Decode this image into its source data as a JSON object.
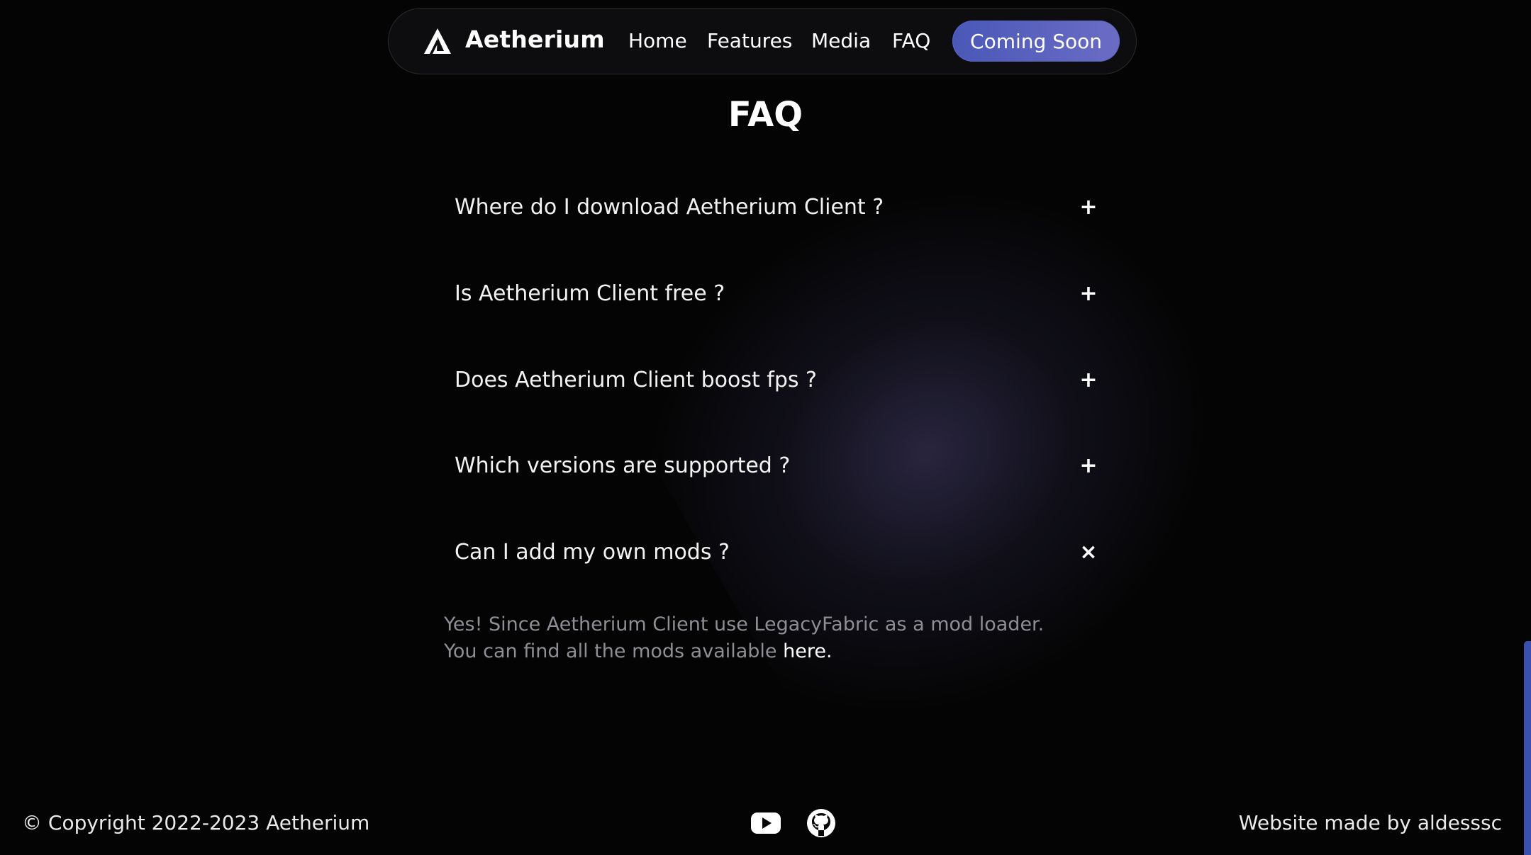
{
  "nav": {
    "brand": "Aetherium",
    "links": [
      "Home",
      "Features",
      "Media",
      "FAQ"
    ],
    "cta": "Coming Soon"
  },
  "faq": {
    "title": "FAQ",
    "items": [
      {
        "question": "Where do I download Aetherium Client ?",
        "toggle": "+"
      },
      {
        "question": "Is Aetherium Client free ?",
        "toggle": "+"
      },
      {
        "question": "Does Aetherium Client boost fps ?",
        "toggle": "+"
      },
      {
        "question": "Which versions are supported ?",
        "toggle": "+"
      },
      {
        "question": "Can I add my own mods ?",
        "toggle": "×"
      }
    ],
    "answer_text": "Yes! Since Aetherium Client use LegacyFabric as a mod loader. You can find all the mods available ",
    "answer_link": "here."
  },
  "footer": {
    "copyright": "© Copyright 2022-2023 Aetherium",
    "credit": "Website made by aldesssc",
    "social_icons": [
      "youtube-icon",
      "github-icon"
    ]
  },
  "colors": {
    "background": "#040404",
    "accent": "#4a58b8",
    "muted_text": "#8e8e94"
  }
}
